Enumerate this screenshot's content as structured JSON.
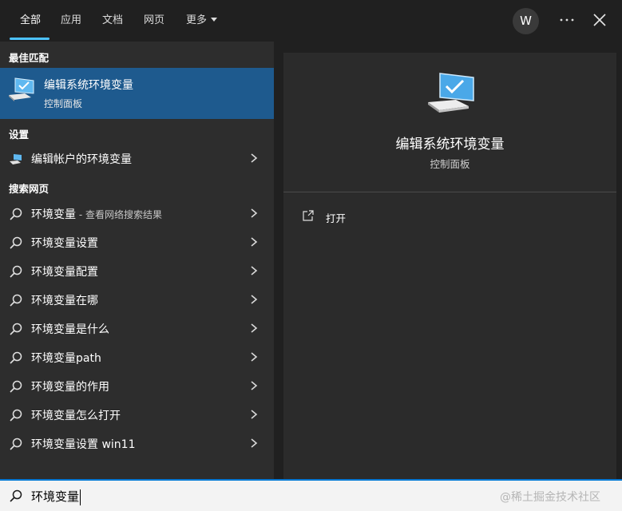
{
  "tabs": [
    {
      "label": "全部",
      "active": true
    },
    {
      "label": "应用"
    },
    {
      "label": "文档"
    },
    {
      "label": "网页"
    },
    {
      "label": "更多"
    }
  ],
  "user": {
    "avatar_letter": "W"
  },
  "left": {
    "best_match_header": "最佳匹配",
    "best_match": {
      "title": "编辑系统环境变量",
      "subtitle": "控制面板",
      "icon": "monitor-icon"
    },
    "settings_header": "设置",
    "settings_items": [
      {
        "label": "编辑帐户的环境变量",
        "icon": "monitor-icon"
      }
    ],
    "web_header": "搜索网页",
    "web_items": [
      {
        "label": "环境变量",
        "hint": " - 查看网络搜索结果"
      },
      {
        "label": "环境变量设置"
      },
      {
        "label": "环境变量配置"
      },
      {
        "label": "环境变量在哪"
      },
      {
        "label": "环境变量是什么"
      },
      {
        "label": "环境变量path"
      },
      {
        "label": "环境变量的作用"
      },
      {
        "label": "环境变量怎么打开"
      },
      {
        "label": "环境变量设置 win11"
      }
    ]
  },
  "right": {
    "title": "编辑系统环境变量",
    "subtitle": "控制面板",
    "actions": [
      {
        "label": "打开",
        "icon": "open-external-icon"
      }
    ]
  },
  "search": {
    "value": "环境变量"
  },
  "watermark": "@稀土掘金技术社区",
  "colors": {
    "accent": "#4cc2ff",
    "selection": "#1e5a8e",
    "searchbar_border": "#0078d4"
  }
}
